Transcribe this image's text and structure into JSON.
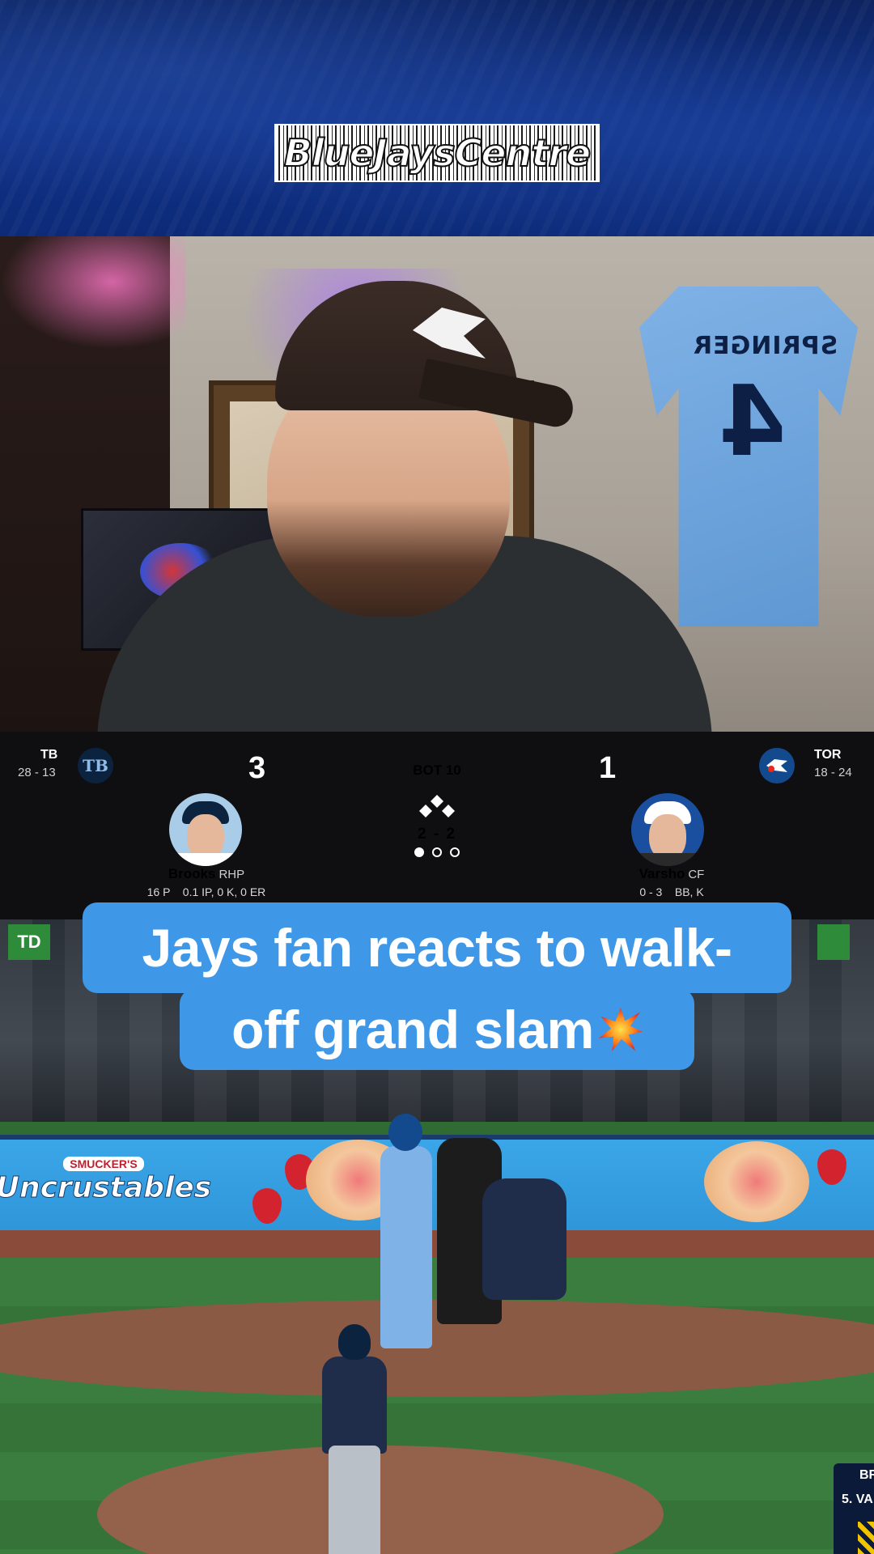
{
  "banner": {
    "logo_text": "BlueJaysCentre"
  },
  "scoreboard": {
    "away": {
      "abbr": "TB",
      "record": "28 - 13",
      "logo_text": "TB",
      "score": "3"
    },
    "home": {
      "abbr": "TOR",
      "record": "18 - 24",
      "score": "1"
    },
    "inning": "BOT 10",
    "count": "2 - 2",
    "outs_filled": 1,
    "pitcher": {
      "name": "Brooks",
      "position": "RHP",
      "stats": "16 P    0.1 IP, 0 K, 0 ER"
    },
    "batter": {
      "name": "Varsho",
      "position": "CF",
      "stats": "0 - 3    BB, K"
    }
  },
  "field": {
    "td_sign": "TD",
    "ad_brand_small": "SMUCKER'S",
    "ad_brand_big": "Uncrustables",
    "jersey_name": "SPRINGER",
    "jersey_number": "4",
    "corner_line1": "BR",
    "corner_line2": "5. VA"
  },
  "caption": {
    "line1": "Jays fan reacts to walk-",
    "line2": "off grand slam"
  },
  "colors": {
    "caption_bg": "#3f97e8",
    "scoreboard_bg": "#0f0f12",
    "banner_bg": "#12338a"
  }
}
